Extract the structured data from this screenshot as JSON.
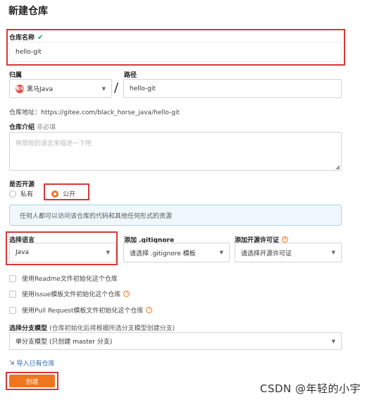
{
  "page": {
    "title": "新建仓库"
  },
  "repo_name": {
    "label": "仓库名称",
    "value": "hello-git"
  },
  "owner": {
    "label": "归属",
    "avatar_text": "黑马",
    "value": "黑马Java"
  },
  "separator": "/",
  "path": {
    "label": "路径",
    "value": "hello-git"
  },
  "repo_address": "仓库地址：https://gitee.com/black_horse_java/hello-git",
  "intro": {
    "label": "仓库介绍",
    "optional": "非必填",
    "placeholder": "用简短的语言来描述一下吧"
  },
  "open_source": {
    "label": "是否开源",
    "private_label": "私有",
    "public_label": "公开",
    "selected": "公开",
    "notice": "任何人都可以访问该仓库的代码和其他任何形式的资源"
  },
  "language": {
    "label": "选择语言",
    "value": "Java"
  },
  "gitignore": {
    "label": "添加 .gitignore",
    "value": "请选择 .gitignore 模板"
  },
  "license": {
    "label": "添加开源许可证",
    "value": "请选择开源许可证"
  },
  "init_options": [
    {
      "label": "使用Readme文件初始化这个仓库",
      "help": false
    },
    {
      "label": "使用Issue模板文件初始化这个仓库",
      "help": true
    },
    {
      "label": "使用Pull Request模板文件初始化这个仓库",
      "help": true
    }
  ],
  "branch_model": {
    "label": "选择分支模型",
    "hint": "(仓库初始化后将根据所选分支模型创建分支)",
    "value": "单分支模型 (只创建 master 分支)"
  },
  "import_link": "导入已有仓库",
  "create_button": "创建",
  "watermark": "CSDN @年轻的小宇",
  "colors": {
    "accent": "#f0751e",
    "highlight_border": "#d9383a",
    "check": "#21a24b"
  }
}
